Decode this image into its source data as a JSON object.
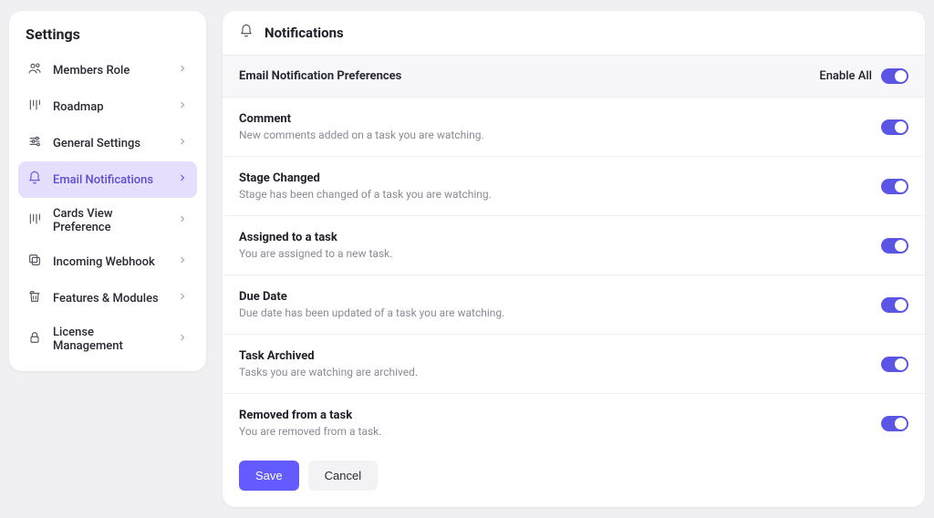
{
  "colors": {
    "accent": "#635bff",
    "accentLight": "#e5dffd"
  },
  "sidebar": {
    "title": "Settings",
    "items": [
      {
        "label": "Members Role",
        "icon": "members-icon",
        "active": false
      },
      {
        "label": "Roadmap",
        "icon": "roadmap-icon",
        "active": false
      },
      {
        "label": "General Settings",
        "icon": "settings-icon",
        "active": false
      },
      {
        "label": "Email Notifications",
        "icon": "bell-icon",
        "active": true
      },
      {
        "label": "Cards View Preference",
        "icon": "cards-icon",
        "active": false
      },
      {
        "label": "Incoming Webhook",
        "icon": "webhook-icon",
        "active": false
      },
      {
        "label": "Features & Modules",
        "icon": "features-icon",
        "active": false
      },
      {
        "label": "License Management",
        "icon": "license-icon",
        "active": false
      }
    ]
  },
  "main": {
    "icon": "bell-icon",
    "title": "Notifications",
    "section_title": "Email Notification Preferences",
    "enable_all_label": "Enable All",
    "enable_all_on": true,
    "prefs": [
      {
        "title": "Comment",
        "desc": "New comments added on a task you are watching.",
        "on": true
      },
      {
        "title": "Stage Changed",
        "desc": "Stage has been changed of a task you are watching.",
        "on": true
      },
      {
        "title": "Assigned to a task",
        "desc": "You are assigned to a new task.",
        "on": true
      },
      {
        "title": "Due Date",
        "desc": "Due date has been updated of a task you are watching.",
        "on": true
      },
      {
        "title": "Task Archived",
        "desc": "Tasks you are watching are archived.",
        "on": true
      },
      {
        "title": "Removed from a task",
        "desc": "You are removed from a task.",
        "on": true
      }
    ],
    "buttons": {
      "save": "Save",
      "cancel": "Cancel"
    }
  }
}
